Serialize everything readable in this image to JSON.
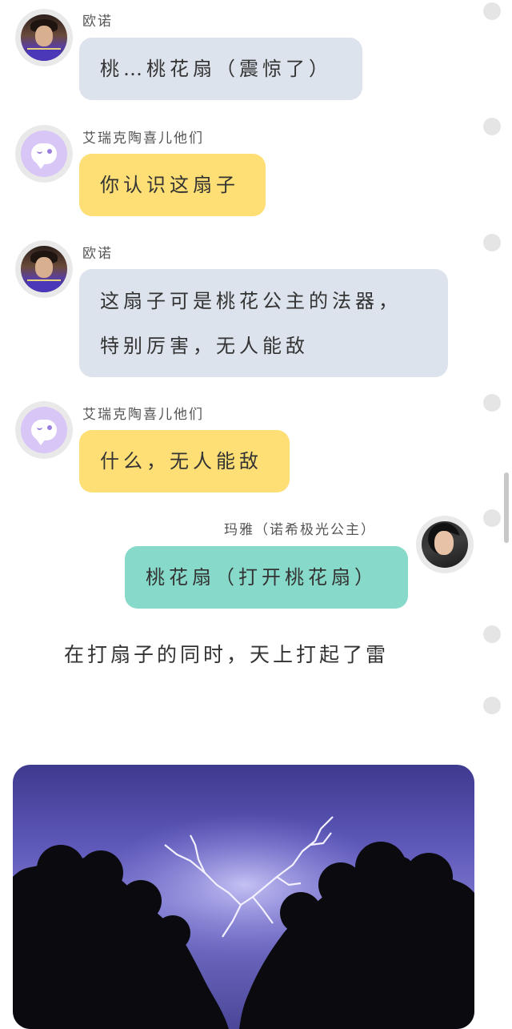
{
  "messages": [
    {
      "sender": "欧诺",
      "text": "桃…桃花扇（震惊了）"
    },
    {
      "sender": "艾瑞克陶喜儿他们",
      "text": "你认识这扇子"
    },
    {
      "sender": "欧诺",
      "line1": "这扇子可是桃花公主的法器，",
      "line2": "特别厉害，无人能敌"
    },
    {
      "sender": "艾瑞克陶喜儿他们",
      "text": "什么，无人能敌"
    },
    {
      "sender": "玛雅（诺希极光公主）",
      "text": "桃花扇（打开桃花扇）"
    }
  ],
  "narration": "在打扇子的同时，天上打起了雷",
  "colors": {
    "gray_bubble": "#dde3ec",
    "yellow_bubble": "#fddf76",
    "teal_bubble": "#87d9ca"
  }
}
